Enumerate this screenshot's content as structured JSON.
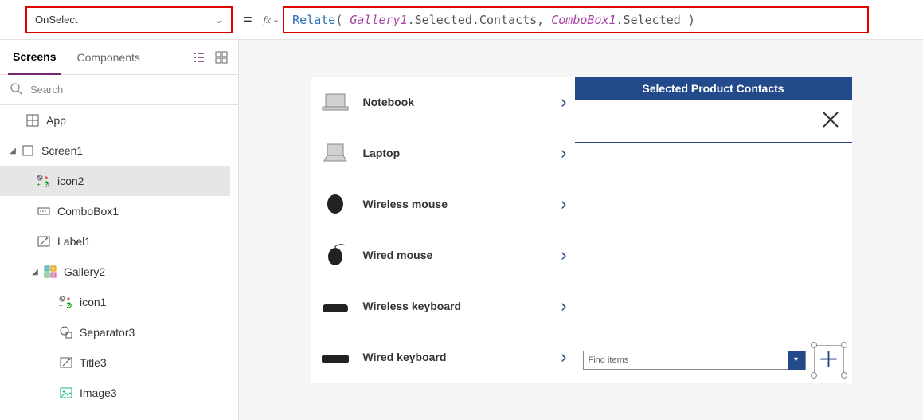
{
  "formula_bar": {
    "property": "OnSelect",
    "equals": "=",
    "fx_label": "fx",
    "formula": {
      "fn": "Relate",
      "open": "( ",
      "id1": "Gallery1",
      "part1": ".Selected.Contacts, ",
      "id2": "ComboBox1",
      "part2": ".Selected )",
      "close": ""
    }
  },
  "left_panel": {
    "tabs": {
      "screens": "Screens",
      "components": "Components"
    },
    "search_placeholder": "Search",
    "tree": {
      "app": "App",
      "screen1": "Screen1",
      "icon2": "icon2",
      "combobox1": "ComboBox1",
      "label1": "Label1",
      "gallery2": "Gallery2",
      "icon1": "icon1",
      "separator3": "Separator3",
      "title3": "Title3",
      "image3": "Image3"
    }
  },
  "canvas": {
    "products": [
      {
        "label": "Notebook"
      },
      {
        "label": "Laptop"
      },
      {
        "label": "Wireless mouse"
      },
      {
        "label": "Wired mouse"
      },
      {
        "label": "Wireless keyboard"
      },
      {
        "label": "Wired keyboard"
      }
    ],
    "header": "Selected Product Contacts",
    "combo_placeholder": "Find items"
  }
}
